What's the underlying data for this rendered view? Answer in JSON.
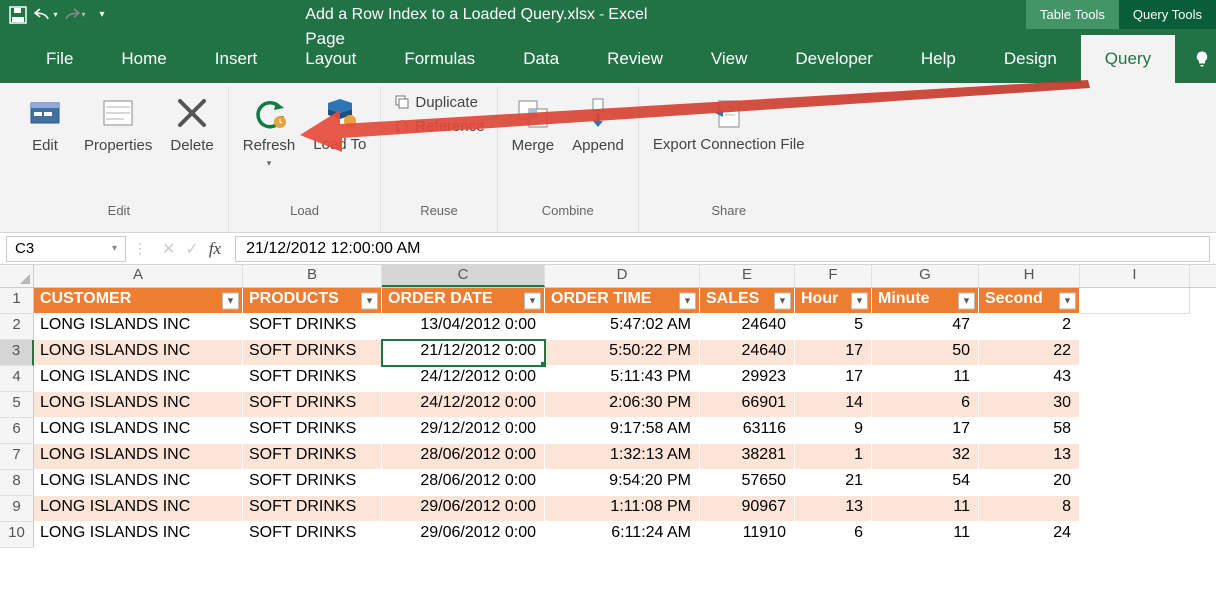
{
  "titlebar": {
    "doc_name": "Add a Row Index to a Loaded Query.xlsx",
    "app_name": "Excel",
    "context_tabs": [
      "Table Tools",
      "Query Tools"
    ]
  },
  "menu": {
    "tabs": [
      "File",
      "Home",
      "Insert",
      "Page Layout",
      "Formulas",
      "Data",
      "Review",
      "View",
      "Developer",
      "Help",
      "Design",
      "Query"
    ],
    "active": "Query",
    "tell": "Tell"
  },
  "ribbon": {
    "groups": [
      {
        "label": "Edit",
        "buttons": [
          {
            "label": "Edit",
            "icon": "edit"
          },
          {
            "label": "Properties",
            "icon": "props"
          },
          {
            "label": "Delete",
            "icon": "delete"
          }
        ]
      },
      {
        "label": "Load",
        "buttons": [
          {
            "label": "Refresh",
            "icon": "refresh",
            "split": true
          },
          {
            "label": "Load To",
            "icon": "loadto"
          }
        ]
      },
      {
        "label": "Reuse",
        "buttons_small": [
          {
            "label": "Duplicate",
            "icon": "dup"
          },
          {
            "label": "Reference",
            "icon": "ref"
          }
        ]
      },
      {
        "label": "Combine",
        "buttons": [
          {
            "label": "Merge",
            "icon": "merge"
          },
          {
            "label": "Append",
            "icon": "append"
          }
        ]
      },
      {
        "label": "Share",
        "buttons": [
          {
            "label": "Export Connection File",
            "icon": "export",
            "wide": true
          }
        ]
      }
    ]
  },
  "addrbar": {
    "namebox": "C3",
    "formula": "21/12/2012  12:00:00 AM"
  },
  "columns": [
    "A",
    "B",
    "C",
    "D",
    "E",
    "F",
    "G",
    "H",
    "I"
  ],
  "selected_col": "C",
  "selected_row": "3",
  "headers": [
    "CUSTOMER",
    "PRODUCTS",
    "ORDER DATE",
    "ORDER TIME",
    "SALES",
    "Hour",
    "Minute",
    "Second"
  ],
  "rows": [
    {
      "rn": 2,
      "c": [
        "LONG ISLANDS INC",
        "SOFT DRINKS",
        "13/04/2012 0:00",
        "5:47:02 AM",
        "24640",
        "5",
        "47",
        "2"
      ]
    },
    {
      "rn": 3,
      "c": [
        "LONG ISLANDS INC",
        "SOFT DRINKS",
        "21/12/2012 0:00",
        "5:50:22 PM",
        "24640",
        "17",
        "50",
        "22"
      ]
    },
    {
      "rn": 4,
      "c": [
        "LONG ISLANDS INC",
        "SOFT DRINKS",
        "24/12/2012 0:00",
        "5:11:43 PM",
        "29923",
        "17",
        "11",
        "43"
      ]
    },
    {
      "rn": 5,
      "c": [
        "LONG ISLANDS INC",
        "SOFT DRINKS",
        "24/12/2012 0:00",
        "2:06:30 PM",
        "66901",
        "14",
        "6",
        "30"
      ]
    },
    {
      "rn": 6,
      "c": [
        "LONG ISLANDS INC",
        "SOFT DRINKS",
        "29/12/2012 0:00",
        "9:17:58 AM",
        "63116",
        "9",
        "17",
        "58"
      ]
    },
    {
      "rn": 7,
      "c": [
        "LONG ISLANDS INC",
        "SOFT DRINKS",
        "28/06/2012 0:00",
        "1:32:13 AM",
        "38281",
        "1",
        "32",
        "13"
      ]
    },
    {
      "rn": 8,
      "c": [
        "LONG ISLANDS INC",
        "SOFT DRINKS",
        "28/06/2012 0:00",
        "9:54:20 PM",
        "57650",
        "21",
        "54",
        "20"
      ]
    },
    {
      "rn": 9,
      "c": [
        "LONG ISLANDS INC",
        "SOFT DRINKS",
        "29/06/2012 0:00",
        "1:11:08 PM",
        "90967",
        "13",
        "11",
        "8"
      ]
    },
    {
      "rn": 10,
      "c": [
        "LONG ISLANDS INC",
        "SOFT DRINKS",
        "29/06/2012 0:00",
        "6:11:24 AM",
        "11910",
        "6",
        "11",
        "24"
      ]
    }
  ]
}
